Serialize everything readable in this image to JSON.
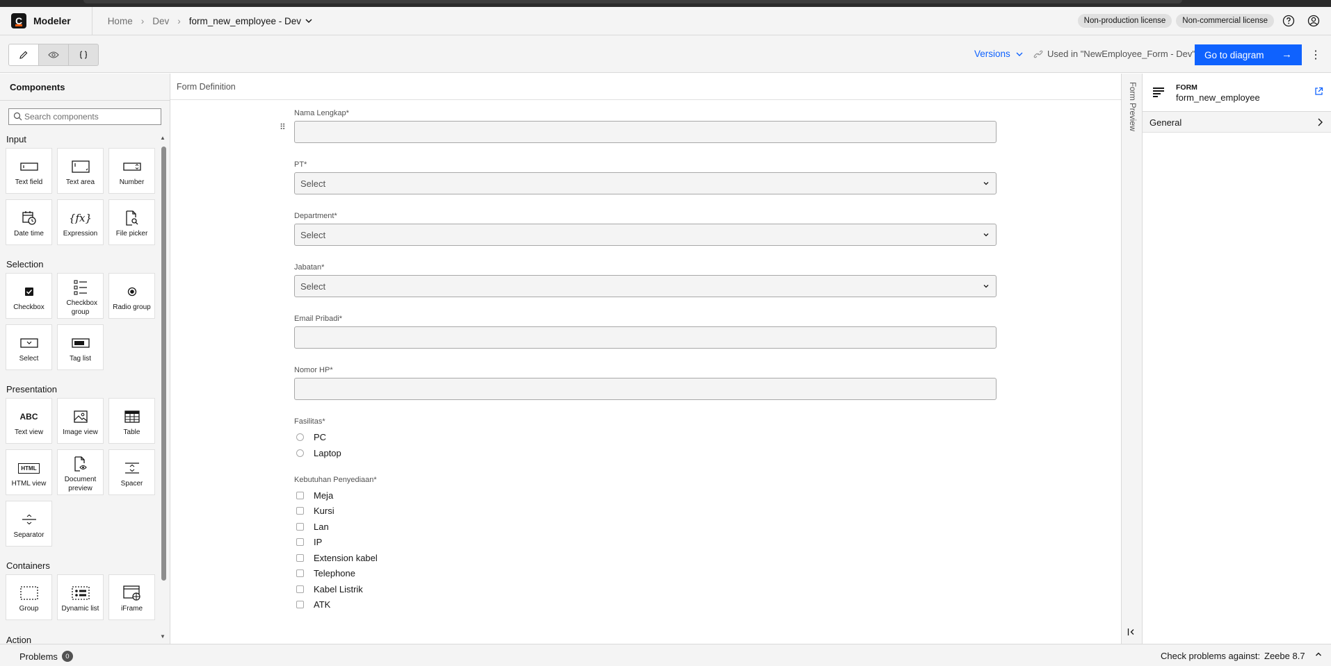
{
  "header": {
    "app_name": "Modeler",
    "logo_letter": "C",
    "breadcrumbs": [
      "Home",
      "Dev"
    ],
    "current_file": "form_new_employee - Dev",
    "licenses": [
      "Non-production license",
      "Non-commercial license"
    ]
  },
  "toolbar": {
    "versions_label": "Versions",
    "used_in": "Used in \"NewEmployee_Form - Dev\"",
    "goto_label": "Go to diagram",
    "modes": [
      "edit-mode",
      "preview-mode",
      "json-mode"
    ]
  },
  "components_panel": {
    "title": "Components",
    "search_placeholder": "Search components",
    "sections": {
      "input": "Input",
      "selection": "Selection",
      "presentation": "Presentation",
      "containers": "Containers",
      "action": "Action"
    },
    "input_items": [
      "Text field",
      "Text area",
      "Number",
      "Date time",
      "Expression",
      "File picker"
    ],
    "selection_items": [
      "Checkbox",
      "Checkbox group",
      "Radio group",
      "Select",
      "Tag list"
    ],
    "presentation_items": [
      "Text view",
      "Image view",
      "Table",
      "HTML view",
      "Document preview",
      "Spacer",
      "Separator"
    ],
    "container_items": [
      "Group",
      "Dynamic list",
      "iFrame"
    ],
    "icon_text": {
      "abc": "ABC",
      "html": "HTML",
      "fx": "{fx}"
    }
  },
  "canvas": {
    "title": "Form Definition",
    "fields": {
      "nama": "Nama Lengkap*",
      "pt": "PT*",
      "department": "Department*",
      "jabatan": "Jabatan*",
      "email": "Email Pribadi*",
      "nomor": "Nomor HP*",
      "fasilitas": "Fasilitas*",
      "kebutuhan": "Kebutuhan Penyediaan*"
    },
    "select_placeholder": "Select",
    "fasilitas_options": [
      "PC",
      "Laptop"
    ],
    "kebutuhan_options": [
      "Meja",
      "Kursi",
      "Lan",
      "IP",
      "Extension kabel",
      "Telephone",
      "Kabel Listrik",
      "ATK"
    ]
  },
  "preview_strip": {
    "label": "Form Preview"
  },
  "properties": {
    "kicker": "FORM",
    "form_id": "form_new_employee",
    "group_label": "General"
  },
  "footer": {
    "problems_label": "Problems",
    "problems_count": "0",
    "check_label": "Check problems against:",
    "engine": "Zeebe 8.7"
  },
  "colors": {
    "accent": "#0f62fe",
    "brand": "#fc5d0d"
  }
}
